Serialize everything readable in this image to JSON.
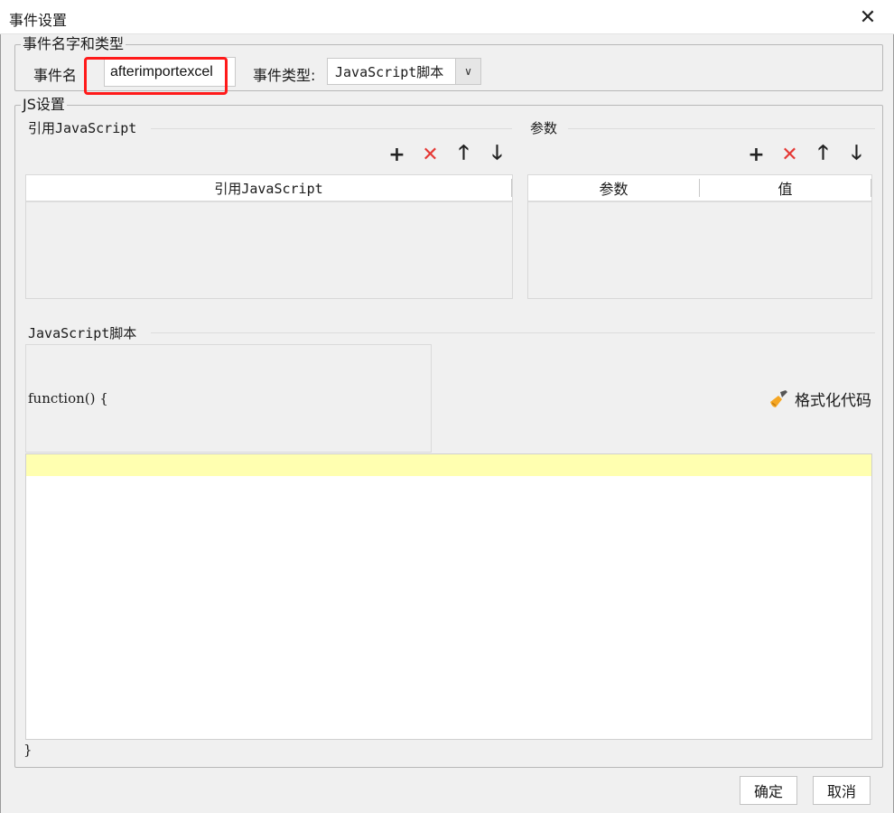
{
  "window": {
    "title": "事件设置",
    "close_glyph": "✕"
  },
  "event_name_group": {
    "legend": "事件名字和类型",
    "name_label": "事件名",
    "name_value": "afterimportexcel",
    "type_label": "事件类型:",
    "type_value": "JavaScript脚本",
    "type_arrow": "∨"
  },
  "js_settings": {
    "legend": "JS设置",
    "ref_section_title": "引用JavaScript",
    "ref_table_header": "引用JavaScript",
    "params_section_title": "参数",
    "params_headers": [
      "参数",
      "值"
    ],
    "toolbar_icons": {
      "add": "+",
      "delete": "✕",
      "up": "🡑",
      "down": "🡓"
    },
    "script_section_title": "JavaScript脚本",
    "function_header": "function() {",
    "format_code_label": "格式化代码",
    "closing_brace": "}"
  },
  "footer": {
    "ok_label": "确定",
    "cancel_label": "取消"
  },
  "colors": {
    "highlight_box": "#ff1a1a",
    "delete_icon": "#e53935",
    "current_line": "#ffffb0"
  }
}
